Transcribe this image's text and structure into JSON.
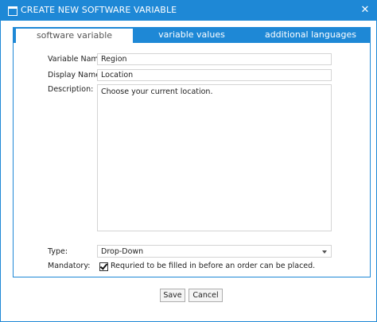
{
  "window": {
    "title": "CREATE NEW SOFTWARE VARIABLE",
    "close_symbol": "✕"
  },
  "tabs": [
    {
      "label": "software variable",
      "active": true
    },
    {
      "label": "variable values",
      "active": false
    },
    {
      "label": "additional languages",
      "active": false
    }
  ],
  "form": {
    "variable_name": {
      "label": "Variable Name:",
      "value": "Region"
    },
    "display_name": {
      "label": "Display Name:",
      "value": "Location"
    },
    "description": {
      "label": "Description:",
      "value": "Choose your current location."
    },
    "type": {
      "label": "Type:",
      "value": "Drop-Down"
    },
    "mandatory": {
      "label": "Mandatory:",
      "checked": true,
      "checkbox_text": "Requried to be filled in before an order can be placed."
    }
  },
  "buttons": {
    "save_label": "Save",
    "cancel_label": "Cancel"
  },
  "colors": {
    "accent": "#1e88d6"
  },
  "icons": {
    "window": "window-icon",
    "close": "close-icon",
    "dropdown": "chevron-down-icon",
    "check": "checkmark-icon"
  }
}
